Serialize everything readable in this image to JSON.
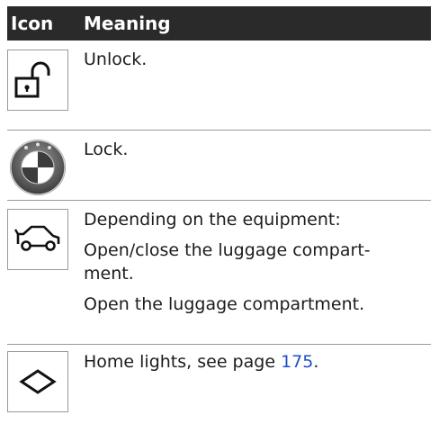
{
  "header": {
    "icon_col": "Icon",
    "meaning_col": "Meaning"
  },
  "rows": [
    {
      "icon": "unlock-padlock-icon",
      "lines": [
        "Unlock."
      ]
    },
    {
      "icon": "bmw-logo-lock-icon",
      "lines": [
        "Lock."
      ]
    },
    {
      "icon": "car-trunk-icon",
      "lines": [
        "Depending on the equipment:",
        "Open/close the luggage compart-\nment.",
        "Open the luggage compartment."
      ]
    },
    {
      "icon": "diamond-home-lights-icon",
      "text_before_link": "Home lights, see page ",
      "link_text": "175",
      "text_after_link": "."
    }
  ],
  "colors": {
    "header_bg": "#2a2a2a",
    "header_text": "#ffffff",
    "link": "#1f4fc9",
    "divider": "#9a9a9a"
  }
}
